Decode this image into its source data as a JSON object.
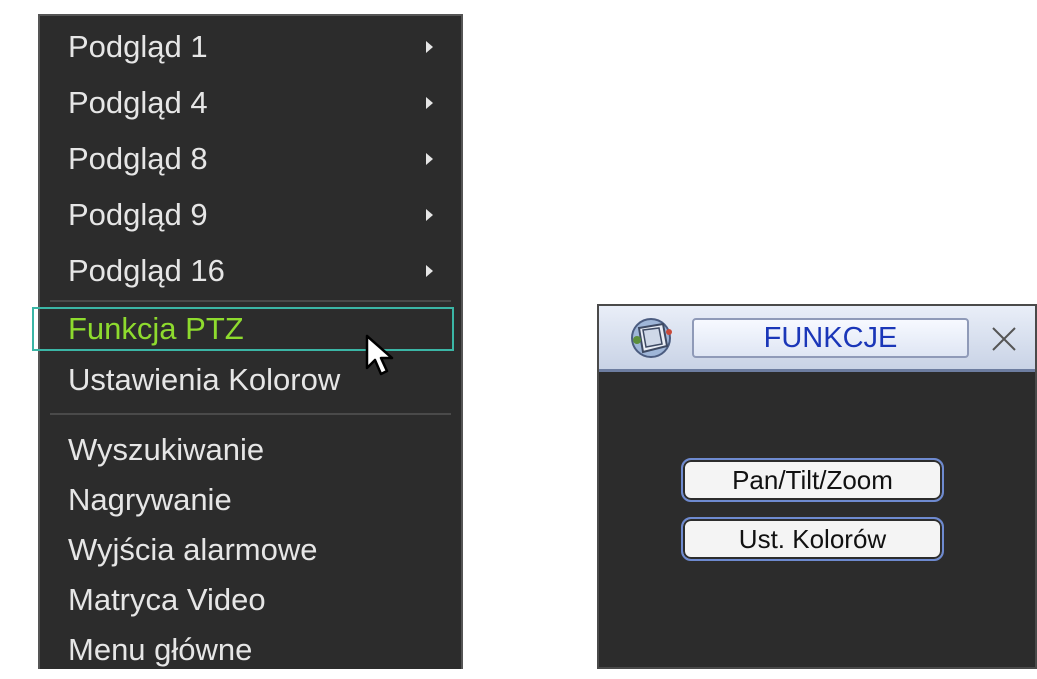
{
  "context_menu": {
    "items": [
      {
        "label": "Podgląd 1",
        "has_submenu": true
      },
      {
        "label": "Podgląd 4",
        "has_submenu": true
      },
      {
        "label": "Podgląd 8",
        "has_submenu": true
      },
      {
        "label": "Podgląd 9",
        "has_submenu": true
      },
      {
        "label": "Podgląd 16",
        "has_submenu": true
      },
      {
        "label": "Funkcja PTZ",
        "highlighted": true
      },
      {
        "label": "Ustawienia Kolorow"
      },
      {
        "label": "Wyszukiwanie"
      },
      {
        "label": "Nagrywanie"
      },
      {
        "label": "Wyjścia alarmowe"
      },
      {
        "label": "Matryca Video"
      },
      {
        "label": "Menu główne"
      }
    ],
    "colors": {
      "background": "#2c2c2c",
      "text": "#e6e6e6",
      "highlight_text": "#8edb2e",
      "highlight_border": "#3bb6a6"
    }
  },
  "dialog": {
    "title": "FUNKCJE",
    "logo_icon": "app-logo-icon",
    "close_icon": "close-icon",
    "buttons": [
      {
        "label": "Pan/Tilt/Zoom"
      },
      {
        "label": "Ust. Kolorów"
      }
    ],
    "colors": {
      "title_text": "#1a36b8",
      "background": "#2c2c2c"
    }
  },
  "cursor": {
    "icon": "mouse-pointer-icon"
  }
}
